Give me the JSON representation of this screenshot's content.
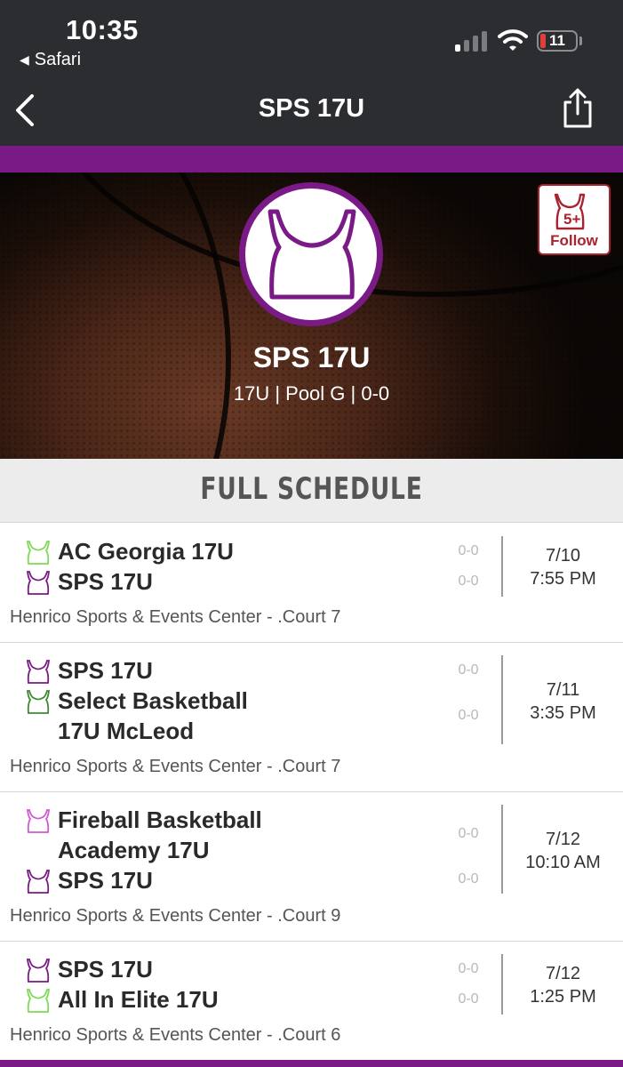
{
  "status_bar": {
    "time": "10:35",
    "back_app": "Safari",
    "battery": "11"
  },
  "nav": {
    "title": "SPS 17U"
  },
  "team": {
    "name": "SPS 17U",
    "subtitle": "17U | Pool G | 0-0",
    "follow_label": "Follow",
    "follow_badge": "5+"
  },
  "section": {
    "title": "FULL SCHEDULE"
  },
  "colors": {
    "purple": "#7a1a86",
    "jersey_green_light": "#7ed957",
    "jersey_green_dark": "#3c8a2e",
    "jersey_pink": "#d05ad0",
    "follow_red": "#a8232f"
  },
  "games": [
    {
      "teams": [
        {
          "name": "AC Georgia 17U",
          "score": "0-0",
          "jersey": "jersey-light-green-icon"
        },
        {
          "name": "SPS 17U",
          "score": "0-0",
          "jersey": "jersey-purple-icon"
        }
      ],
      "date": "7/10",
      "time": "7:55 PM",
      "venue": "Henrico Sports & Events Center - .Court 7"
    },
    {
      "teams": [
        {
          "name": "SPS 17U",
          "score": "0-0",
          "jersey": "jersey-purple-icon"
        },
        {
          "name": "Select Basketball 17U McLeod",
          "score": "0-0",
          "jersey": "jersey-dark-green-icon"
        }
      ],
      "date": "7/11",
      "time": "3:35 PM",
      "venue": "Henrico Sports & Events Center - .Court 7"
    },
    {
      "teams": [
        {
          "name": "Fireball Basketball Academy 17U",
          "score": "0-0",
          "jersey": "jersey-pink-icon"
        },
        {
          "name": "SPS 17U",
          "score": "0-0",
          "jersey": "jersey-purple-icon"
        }
      ],
      "date": "7/12",
      "time": "10:10 AM",
      "venue": "Henrico Sports & Events Center - .Court 9"
    },
    {
      "teams": [
        {
          "name": "SPS 17U",
          "score": "0-0",
          "jersey": "jersey-purple-icon"
        },
        {
          "name": "All In Elite 17U",
          "score": "0-0",
          "jersey": "jersey-light-green-icon"
        }
      ],
      "date": "7/12",
      "time": "1:25 PM",
      "venue": "Henrico Sports & Events Center - .Court 6"
    }
  ]
}
